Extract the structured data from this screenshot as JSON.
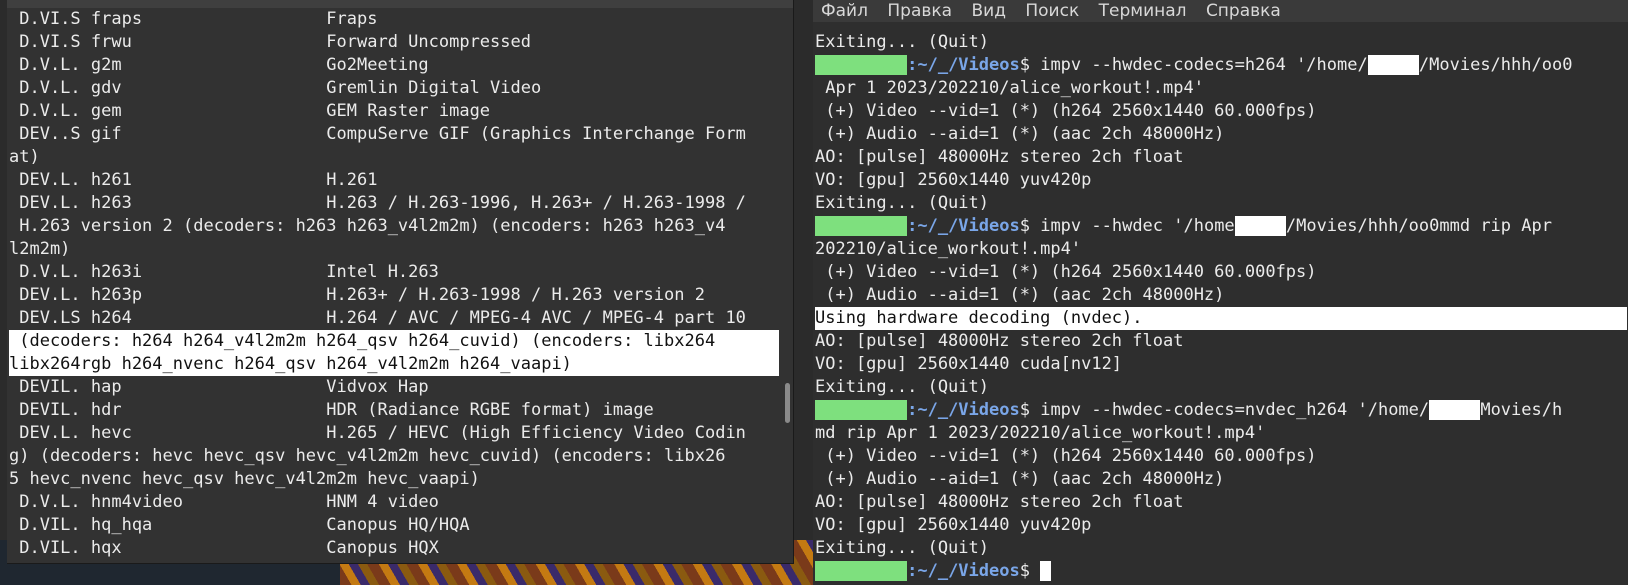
{
  "left_terminal": {
    "lines": [
      {
        "text": " D.VI.S fraps                  Fraps",
        "hl": false
      },
      {
        "text": " D.VI.S frwu                   Forward Uncompressed",
        "hl": false
      },
      {
        "text": " D.V.L. g2m                    Go2Meeting",
        "hl": false
      },
      {
        "text": " D.V.L. gdv                    Gremlin Digital Video",
        "hl": false
      },
      {
        "text": " D.V.L. gem                    GEM Raster image",
        "hl": false
      },
      {
        "text": " DEV..S gif                    CompuServe GIF (Graphics Interchange Form",
        "hl": false
      },
      {
        "text": "at)",
        "hl": false
      },
      {
        "text": " DEV.L. h261                   H.261",
        "hl": false
      },
      {
        "text": " DEV.L. h263                   H.263 / H.263-1996, H.263+ / H.263-1998 /",
        "hl": false
      },
      {
        "text": " H.263 version 2 (decoders: h263 h263_v4l2m2m) (encoders: h263 h263_v4",
        "hl": false
      },
      {
        "text": "l2m2m)",
        "hl": false
      },
      {
        "text": " D.V.L. h263i                  Intel H.263",
        "hl": false
      },
      {
        "text": " DEV.L. h263p                  H.263+ / H.263-1998 / H.263 version 2",
        "hl": false
      },
      {
        "text": " DEV.LS h264                   H.264 / AVC / MPEG-4 AVC / MPEG-4 part 10",
        "hl": false
      },
      {
        "text": " (decoders: h264 h264_v4l2m2m h264_qsv h264_cuvid) (encoders: libx264",
        "hl": true
      },
      {
        "text": "libx264rgb h264_nvenc h264_qsv h264_v4l2m2m h264_vaapi)",
        "hl": true
      },
      {
        "text": " DEVIL. hap                    Vidvox Hap",
        "hl": false
      },
      {
        "text": " DEVIL. hdr                    HDR (Radiance RGBE format) image",
        "hl": false
      },
      {
        "text": " DEV.L. hevc                   H.265 / HEVC (High Efficiency Video Codin",
        "hl": false
      },
      {
        "text": "g) (decoders: hevc hevc_qsv hevc_v4l2m2m hevc_cuvid) (encoders: libx26",
        "hl": false
      },
      {
        "text": "5 hevc_nvenc hevc_qsv hevc_v4l2m2m hevc_vaapi)",
        "hl": false
      },
      {
        "text": " D.V.L. hnm4video              HNM 4 video",
        "hl": false
      },
      {
        "text": " D.VIL. hq_hqa                 Canopus HQ/HQA",
        "hl": false
      },
      {
        "text": " D.VIL. hqx                    Canopus HQX",
        "hl": false
      }
    ]
  },
  "right_terminal": {
    "menu": [
      "Файл",
      "Правка",
      "Вид",
      "Поиск",
      "Терминал",
      "Справка"
    ],
    "prompt_path": ":~/_/Videos",
    "prompt_sign": "$ ",
    "lines": {
      "l0": "Exiting... (Quit)",
      "cmd1": "impv --hwdec-codecs=h264 '/home/",
      "cmd1b": "/Movies/hhh/oo0",
      "l2": " Apr 1 2023/202210/alice_workout!.mp4'",
      "l3": " (+) Video --vid=1 (*) (h264 2560x1440 60.000fps)",
      "l4": " (+) Audio --aid=1 (*) (aac 2ch 48000Hz)",
      "l5": "AO: [pulse] 48000Hz stereo 2ch float",
      "l6": "VO: [gpu] 2560x1440 yuv420p",
      "l7": "Exiting... (Quit)",
      "cmd2": "impv --hwdec '/home",
      "cmd2b": "/Movies/hhh/oo0mmd rip Apr",
      "l9": "202210/alice_workout!.mp4'",
      "l10": " (+) Video --vid=1 (*) (h264 2560x1440 60.000fps)",
      "l11": " (+) Audio --aid=1 (*) (aac 2ch 48000Hz)",
      "l12": "Using hardware decoding (nvdec).",
      "l13": "AO: [pulse] 48000Hz stereo 2ch float",
      "l14": "VO: [gpu] 2560x1440 cuda[nv12]",
      "l15": "Exiting... (Quit)",
      "cmd3": "impv --hwdec-codecs=nvdec_h264 '/home/",
      "cmd3b": "Movies/h",
      "l17": "md rip Apr 1 2023/202210/alice_workout!.mp4'",
      "l18": " (+) Video --vid=1 (*) (h264 2560x1440 60.000fps)",
      "l19": " (+) Audio --aid=1 (*) (aac 2ch 48000Hz)",
      "l20": "AO: [pulse] 48000Hz stereo 2ch float",
      "l21": "VO: [gpu] 2560x1440 yuv420p",
      "l22": "Exiting... (Quit)"
    }
  },
  "colors": {
    "prompt_user": "#7ee07e",
    "prompt_path": "#7aa6e8",
    "highlight_bg": "#ffffff",
    "terminal_bg": "#2e2e2e"
  }
}
